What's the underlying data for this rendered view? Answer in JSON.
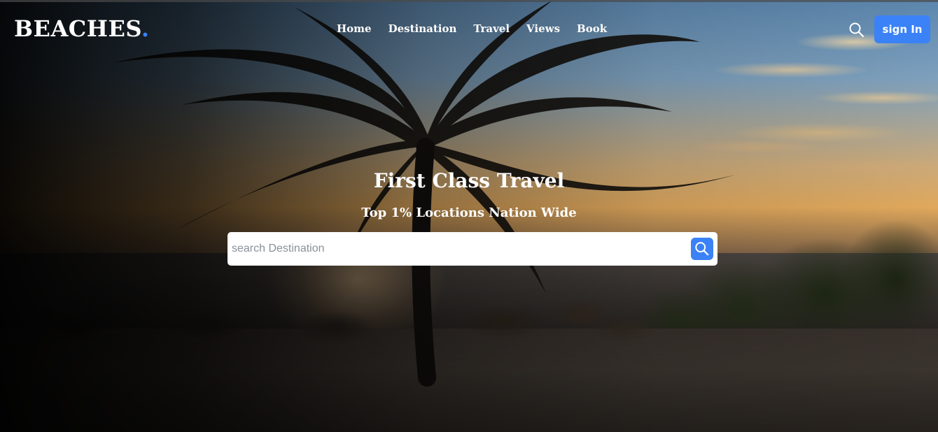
{
  "header": {
    "logo_text": "BEACHES",
    "logo_dot": ".",
    "nav": [
      {
        "label": "Home"
      },
      {
        "label": "Destination"
      },
      {
        "label": "Travel"
      },
      {
        "label": "Views"
      },
      {
        "label": "Book"
      }
    ],
    "search_icon": "search-icon",
    "signin_label": "sign In"
  },
  "hero": {
    "title": "First Class Travel",
    "subtitle": "Top 1% Locations Nation Wide",
    "search": {
      "placeholder": "search Destination",
      "value": "",
      "button_icon": "search-icon"
    },
    "background": "beach-palm-sunset-photo"
  },
  "colors": {
    "accent": "#3b82f6",
    "text": "#ffffff"
  }
}
